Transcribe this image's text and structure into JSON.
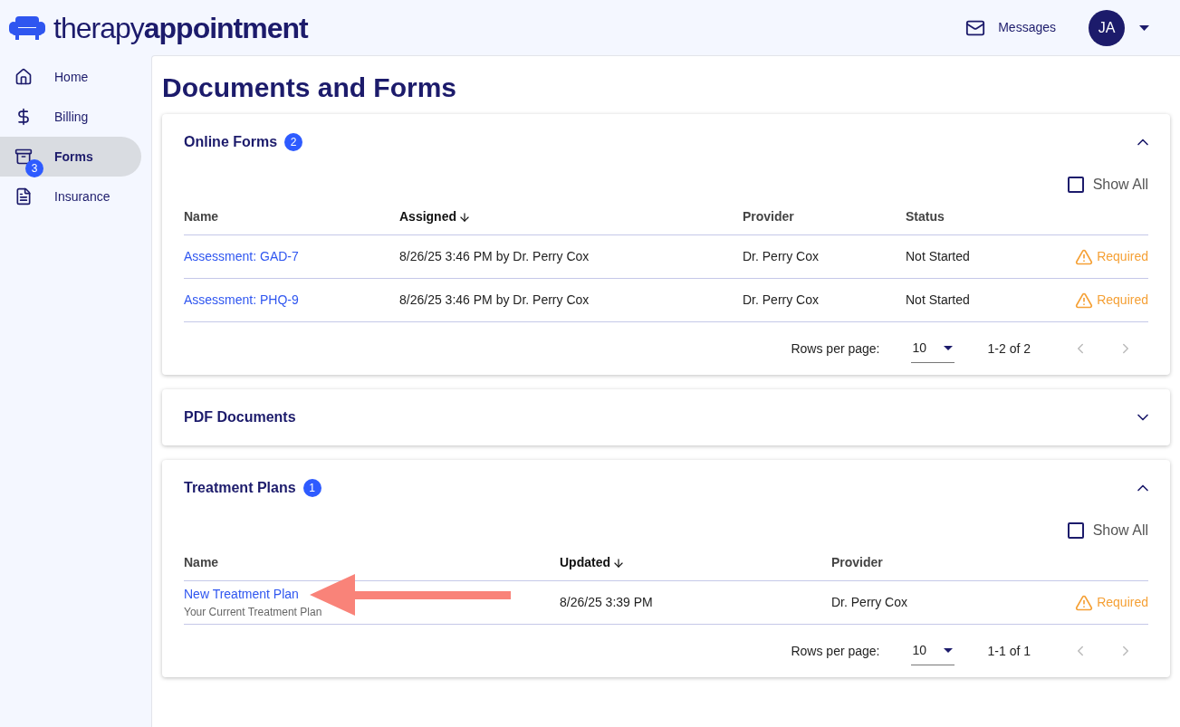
{
  "header": {
    "logo": {
      "light": "therapy",
      "bold": "appointment"
    },
    "messages": "Messages",
    "avatar": "JA"
  },
  "sidebar": {
    "items": [
      {
        "kind": "home",
        "label": "Home",
        "selected": false
      },
      {
        "kind": "billing",
        "label": "Billing",
        "selected": false
      },
      {
        "kind": "forms",
        "label": "Forms",
        "badge": "3",
        "selected": true
      },
      {
        "kind": "insurance",
        "label": "Insurance",
        "selected": false
      }
    ]
  },
  "page_title": "Documents and Forms",
  "panels": [
    {
      "title": "Online Forms",
      "badge": "2",
      "expanded": true,
      "show_all": {
        "label": "Show All",
        "checked": false
      },
      "columns": [
        {
          "label": "Name",
          "sorted": false
        },
        {
          "label": "Assigned",
          "sorted": true
        },
        {
          "label": "Provider",
          "sorted": false
        },
        {
          "label": "Status",
          "sorted": false
        }
      ],
      "rows": [
        {
          "cells": [
            "Assessment: GAD-7",
            "8/26/25 3:46 PM by Dr. Perry Cox",
            "Dr. Perry Cox",
            "Not Started"
          ],
          "flag": "Required"
        },
        {
          "cells": [
            "Assessment: PHQ-9",
            "8/26/25 3:46 PM by Dr. Perry Cox",
            "Dr. Perry Cox",
            "Not Started"
          ],
          "flag": "Required"
        }
      ],
      "pagination": {
        "label": "Rows per page:",
        "rows_per_page": "10",
        "range": "1-2 of 2",
        "prev_disabled": true,
        "next_disabled": true
      }
    },
    {
      "title": "PDF Documents",
      "expanded": false
    },
    {
      "title": "Treatment Plans",
      "badge": "1",
      "expanded": true,
      "show_all": {
        "label": "Show All",
        "checked": false
      },
      "columns": [
        {
          "label": "Name",
          "sorted": false
        },
        {
          "label": "Updated",
          "sorted": true
        },
        {
          "label": "Provider",
          "sorted": false
        }
      ],
      "rows": [
        {
          "cells": [
            "New Treatment Plan",
            "8/26/25 3:39 PM",
            "Dr. Perry Cox"
          ],
          "subtitle": "Your Current Treatment Plan",
          "flag": "Required",
          "pointer": true
        }
      ],
      "pagination": {
        "label": "Rows per page:",
        "rows_per_page": "10",
        "range": "1-1 of 1",
        "prev_disabled": true,
        "next_disabled": true
      }
    }
  ]
}
